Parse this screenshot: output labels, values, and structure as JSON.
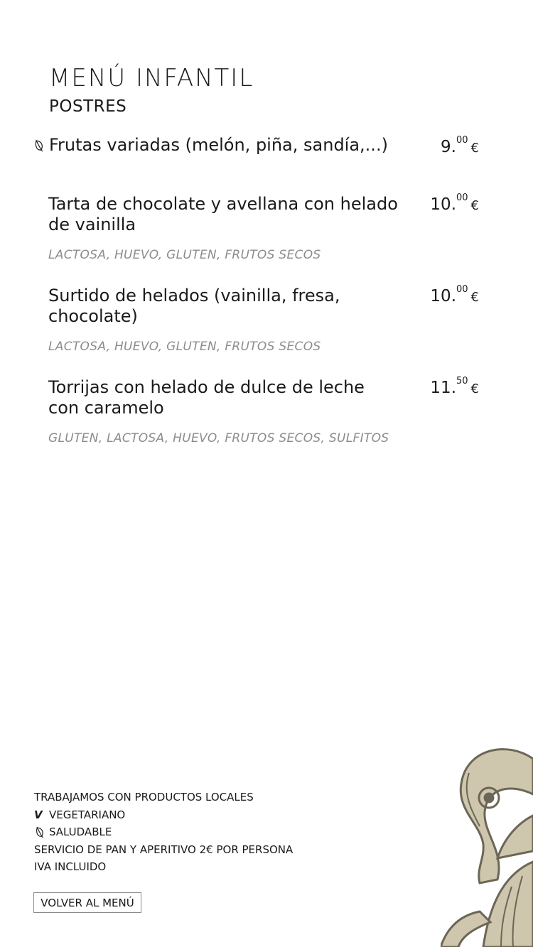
{
  "header": {
    "title": "MENÚ INFANTIL",
    "subtitle": "POSTRES"
  },
  "items": [
    {
      "name": "Frutas variadas (melón, piña, sandía,...)",
      "price_int": "9.",
      "price_dec": "00",
      "currency": "€",
      "allergens": "",
      "icon": "leaf-icon"
    },
    {
      "name": "Tarta de chocolate y avellana con helado de vainilla",
      "price_int": "10.",
      "price_dec": "00",
      "currency": "€",
      "allergens": "LACTOSA, HUEVO, GLUTEN, FRUTOS SECOS"
    },
    {
      "name": "Surtido de helados (vainilla, fresa, chocolate)",
      "price_int": "10.",
      "price_dec": "00",
      "currency": "€",
      "allergens": "LACTOSA, HUEVO, GLUTEN, FRUTOS SECOS"
    },
    {
      "name": "Torrijas con helado de dulce de leche con caramelo",
      "price_int": "11.",
      "price_dec": "50",
      "currency": "€",
      "allergens": "GLUTEN, LACTOSA, HUEVO, FRUTOS SECOS, SULFITOS"
    }
  ],
  "footer": {
    "local_products": "TRABAJAMOS CON PRODUCTOS LOCALES",
    "vegetarian_symbol": "V",
    "vegetarian": "VEGETARIANO",
    "healthy": "SALUDABLE",
    "bread_service": "SERVICIO DE PAN Y APERITIVO 2€ POR PERSONA",
    "vat": "IVA INCLUIDO",
    "back_button": "VOLVER AL MENÚ"
  },
  "colors": {
    "text": "#1a1a1a",
    "allergen": "#8c8c8c",
    "ornament_dark": "#6b6656",
    "ornament_light": "#cfc6ae"
  }
}
